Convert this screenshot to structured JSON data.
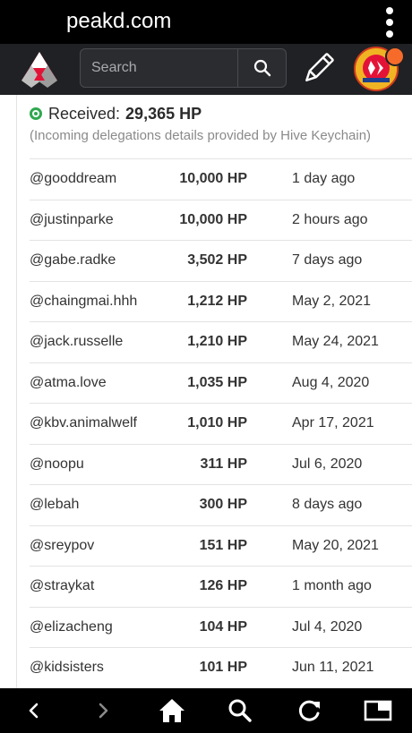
{
  "browser": {
    "url": "peakd.com"
  },
  "header": {
    "search_placeholder": "Search"
  },
  "received": {
    "label": "Received:",
    "value": "29,365 HP",
    "note": "(Incoming delegations details provided by Hive Keychain)"
  },
  "delegations": [
    {
      "user": "@gooddream",
      "hp": "10,000 HP",
      "date": "1 day ago"
    },
    {
      "user": "@justinparke",
      "hp": "10,000 HP",
      "date": "2 hours ago"
    },
    {
      "user": "@gabe.radke",
      "hp": "3,502 HP",
      "date": "7 days ago"
    },
    {
      "user": "@chaingmai.hhh",
      "hp": "1,212 HP",
      "date": "May 2, 2021"
    },
    {
      "user": "@jack.russelle",
      "hp": "1,210 HP",
      "date": "May 24, 2021"
    },
    {
      "user": "@atma.love",
      "hp": "1,035 HP",
      "date": "Aug 4, 2020"
    },
    {
      "user": "@kbv.animalwelf",
      "hp": "1,010 HP",
      "date": "Apr 17, 2021"
    },
    {
      "user": "@noopu",
      "hp": "311 HP",
      "date": "Jul 6, 2020"
    },
    {
      "user": "@lebah",
      "hp": "300 HP",
      "date": "8 days ago"
    },
    {
      "user": "@sreypov",
      "hp": "151 HP",
      "date": "May 20, 2021"
    },
    {
      "user": "@straykat",
      "hp": "126 HP",
      "date": "1 month ago"
    },
    {
      "user": "@elizacheng",
      "hp": "104 HP",
      "date": "Jul 4, 2020"
    },
    {
      "user": "@kidsisters",
      "hp": "101 HP",
      "date": "Jun 11, 2021"
    }
  ],
  "colors": {
    "header_bg": "#202124",
    "accent_red": "#e31337",
    "received_green": "#2fa84f",
    "notification": "#f76b2a"
  },
  "icons": {
    "menu": "more-vertical-icon",
    "logo": "peakd-logo",
    "search": "search-icon",
    "write": "pencil-icon",
    "back": "chevron-left-icon",
    "forward": "chevron-right-icon",
    "home": "home-icon",
    "find": "search-icon",
    "reload": "reload-icon",
    "tabs": "tabs-icon"
  }
}
